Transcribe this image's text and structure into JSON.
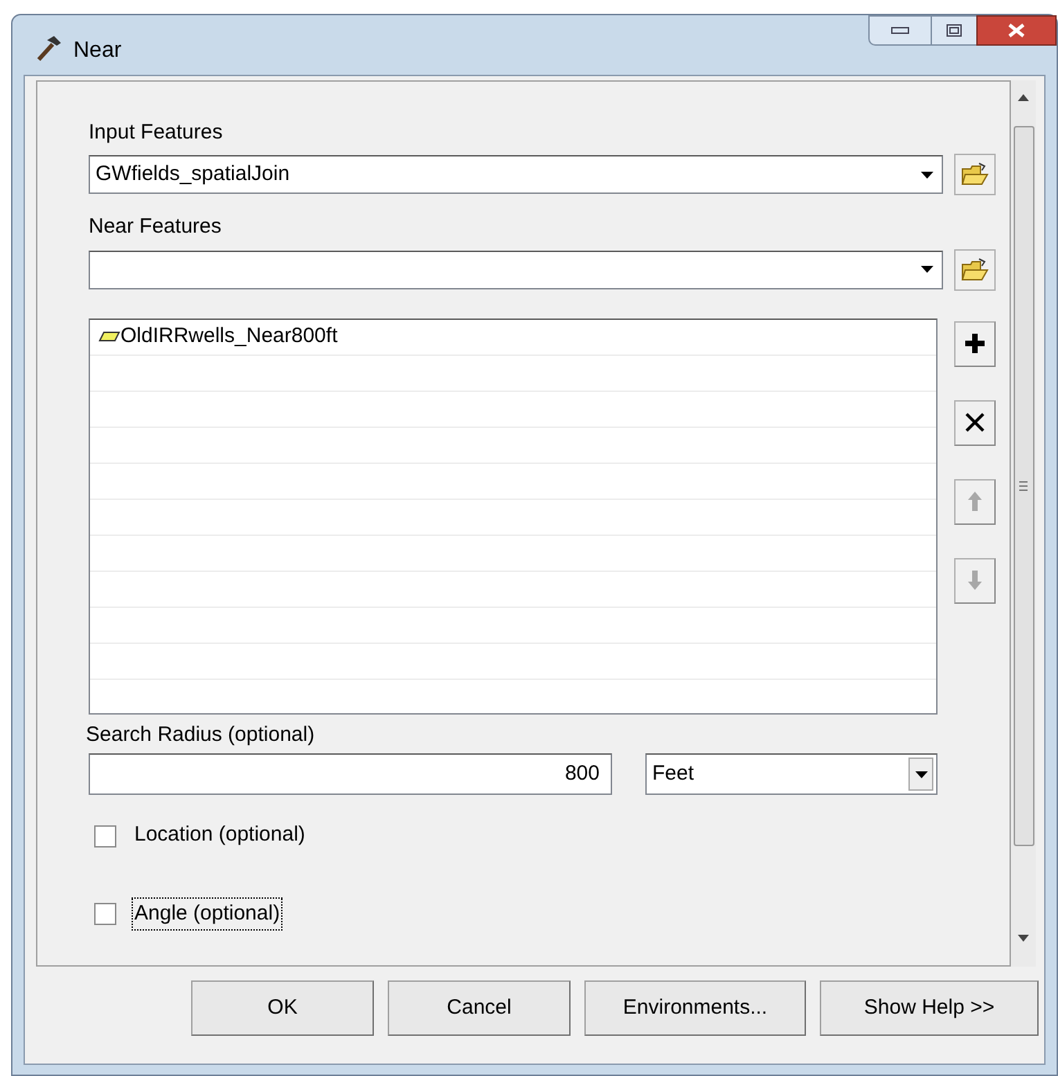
{
  "window": {
    "title": "Near"
  },
  "input_features": {
    "label": "Input Features",
    "value": "GWfields_spatialJoin"
  },
  "near_features": {
    "label": "Near Features"
  },
  "near_list": {
    "items": [
      {
        "label": "OldIRRwells_Near800ft"
      }
    ],
    "buttons": [
      {
        "kind": "add",
        "disabled": false
      },
      {
        "kind": "remove",
        "disabled": false
      },
      {
        "kind": "up",
        "disabled": true
      },
      {
        "kind": "down",
        "disabled": true
      }
    ]
  },
  "search_radius": {
    "label": "Search Radius (optional)",
    "value": "800",
    "unit": "Feet"
  },
  "options": [
    {
      "label": "Location (optional)",
      "checked": false,
      "focused": false
    },
    {
      "label": "Angle (optional)",
      "checked": false,
      "focused": true
    }
  ],
  "buttons": [
    {
      "label": "OK"
    },
    {
      "label": "Cancel"
    },
    {
      "label": "Environments..."
    },
    {
      "label": "Show Help >>"
    }
  ]
}
